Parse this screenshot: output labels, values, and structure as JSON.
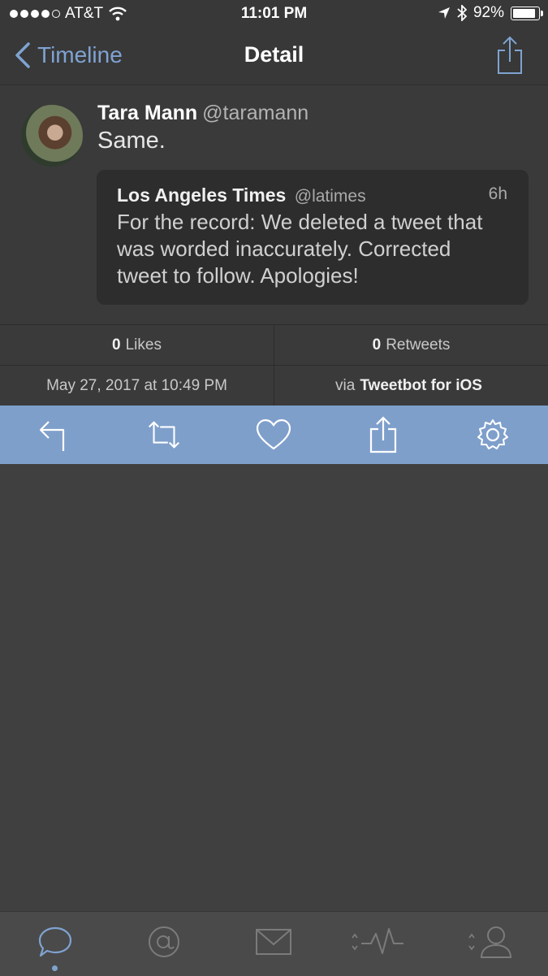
{
  "status_bar": {
    "carrier": "AT&T",
    "time": "11:01 PM",
    "battery": "92%",
    "battery_level": 0.92,
    "signal_bars": 4,
    "icons": [
      "wifi-icon",
      "location-icon",
      "bluetooth-icon",
      "battery-icon"
    ]
  },
  "nav": {
    "back_label": "Timeline",
    "title": "Detail",
    "share_icon": "share-icon"
  },
  "tweet": {
    "name": "Tara Mann",
    "handle": "@taramann",
    "text": "Same.",
    "quoted": {
      "name": "Los Angeles Times",
      "handle": "@latimes",
      "time": "6h",
      "text": "For the record: We deleted a tweet that was worded inaccurately. Corrected tweet to follow. Apologies!"
    }
  },
  "stats": {
    "likes_count": "0",
    "likes_label": "Likes",
    "retweets_count": "0",
    "retweets_label": "Retweets",
    "date": "May 27, 2017 at 10:49 PM",
    "via_prefix": "via",
    "client": "Tweetbot for iOS"
  },
  "actions": [
    "reply-icon",
    "retweet-icon",
    "like-icon",
    "share-icon",
    "settings-icon"
  ],
  "colors": {
    "accent": "#7fa3d1",
    "toolbar": "#7f9fcb",
    "background": "#404040"
  },
  "tabbar": [
    "timeline-tab",
    "mentions-tab",
    "messages-tab",
    "activity-tab",
    "profile-tab"
  ]
}
